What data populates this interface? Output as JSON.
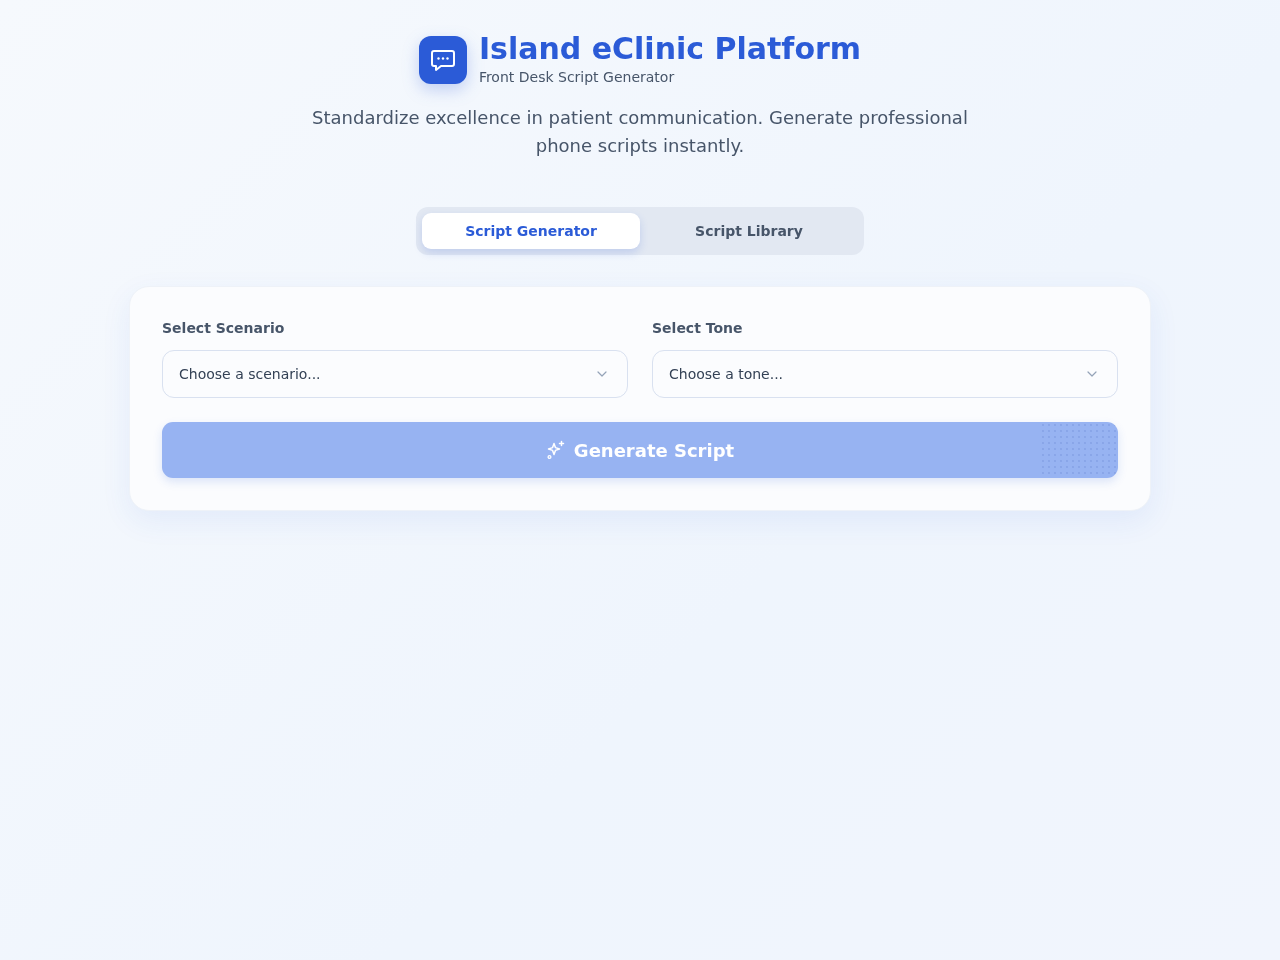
{
  "header": {
    "title": "Island eClinic Platform",
    "subtitle": "Front Desk Script Generator",
    "description": "Standardize excellence in patient communication. Generate professional phone scripts instantly."
  },
  "tabs": [
    {
      "label": "Script Generator",
      "selected": true
    },
    {
      "label": "Script Library",
      "selected": false
    }
  ],
  "form": {
    "fields": [
      {
        "label": "Select Scenario",
        "placeholder": "Choose a scenario..."
      },
      {
        "label": "Select Tone",
        "placeholder": "Choose a tone..."
      }
    ],
    "generate_button": {
      "label": "Generate Script",
      "disabled": true
    }
  }
}
